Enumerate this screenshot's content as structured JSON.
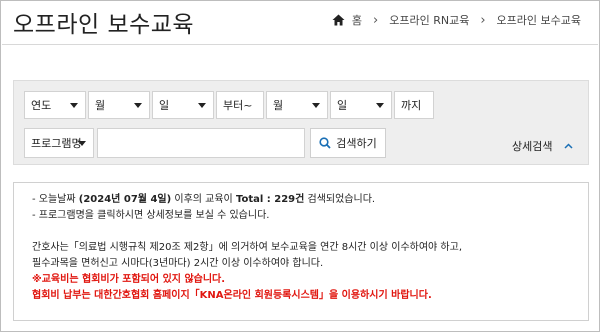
{
  "header": {
    "title": "오프라인 보수교육",
    "breadcrumb": [
      "홈",
      "오프라인 RN교육",
      "오프라인 보수교육"
    ]
  },
  "filters": {
    "year": "연도",
    "month_from": "월",
    "day_from": "일",
    "from_label": "부터~",
    "month_to": "월",
    "day_to": "일",
    "to_label": "까지",
    "program_select": "프로그램명",
    "search_value": "",
    "search_button": "검색하기",
    "detail_search": "상세검색"
  },
  "info": {
    "line1_prefix": "- 오늘날짜 ",
    "line1_date": "(2024년 07월 4일)",
    "line1_mid": " 이후의 교육이 ",
    "line1_total": "Total : 229건",
    "line1_suffix": " 검색되었습니다.",
    "line2": "- 프로그램명을 클릭하시면 상세정보를 보실 수 있습니다.",
    "line3": "간호사는「의료법 시행규칙 제20조 제2항」에 의거하여 보수교육을 연간 8시간 이상 이수하여야 하고,",
    "line4": "필수과목을 면허신고 시마다(3년마다) 2시간 이상 이수하여야 합니다.",
    "line5": "※교육비는 협회비가 포함되어 있지 않습니다.",
    "line6": "협회비 납부는 대한간호협회 홈페이지「KNA온라인 회원등록시스템」을 이용하시기 바랍니다."
  },
  "colors": {
    "panel_bg": "#eeeeee",
    "notice_red": "#e1160f",
    "search_icon": "#1a6fb5",
    "chevron_blue": "#1a6fb5"
  }
}
